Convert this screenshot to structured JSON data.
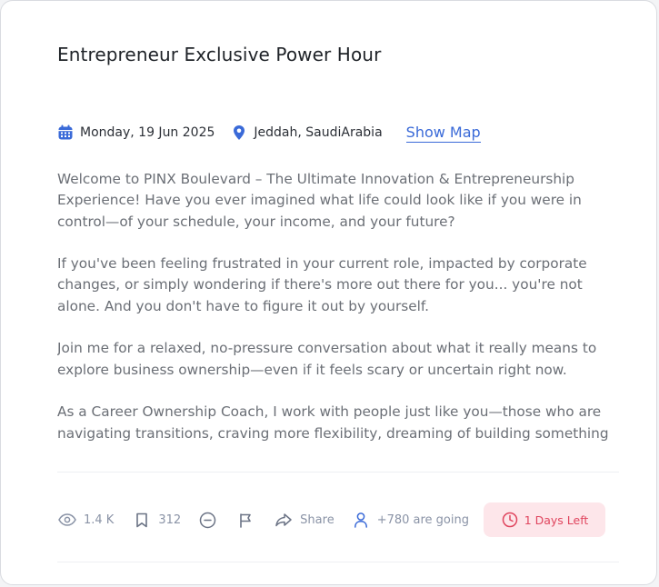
{
  "event": {
    "title": "Entrepreneur Exclusive Power Hour",
    "date": "Monday, 19 Jun 2025",
    "location": "Jeddah, SaudiArabia",
    "show_map_label": "Show Map",
    "description": [
      "Welcome to PINX Boulevard – The Ultimate Innovation & Entrepreneurship Experience! Have you ever imagined what life could look like if you were in control—of your schedule, your income, and your future?",
      "If you've been feeling frustrated in your current role, impacted by corporate changes, or simply wondering if there's more out there for you... you're not alone. And you don't have to figure it out by yourself.",
      "Join me for a relaxed, no-pressure conversation about what it really means to explore business ownership—even if it feels scary or uncertain right now.",
      "As a Career Ownership Coach, I work with people just like you—those who are navigating transitions, craving more flexibility, dreaming of building something"
    ]
  },
  "actions": {
    "views": "1.4 K",
    "bookmarks": "312",
    "share_label": "Share",
    "going_label": "+780 are going",
    "days_left_label": "1 Days Left"
  },
  "icons": {
    "calendar": "calendar-icon",
    "location": "location-pin-icon",
    "views": "eye-icon",
    "bookmark": "bookmark-icon",
    "hide": "minus-circle-icon",
    "report": "flag-icon",
    "share": "share-icon",
    "going": "user-icon",
    "clock": "clock-icon"
  },
  "colors": {
    "accent": "#3a6ad8",
    "muted": "#8a93a6",
    "days_left_bg": "#fde6ea",
    "days_left_text": "#e0455e"
  }
}
